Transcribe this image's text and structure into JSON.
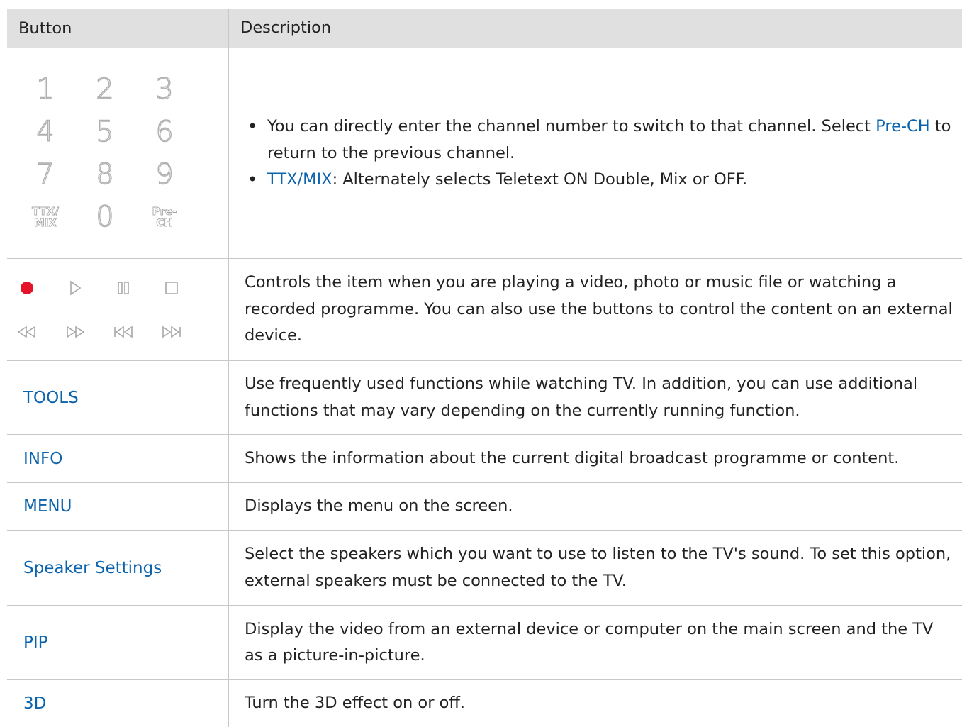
{
  "table": {
    "headers": {
      "button": "Button",
      "description": "Description"
    },
    "numpad": {
      "keys": [
        "1",
        "2",
        "3",
        "4",
        "5",
        "6",
        "7",
        "8",
        "9",
        "TTX/\nMIX",
        "0",
        "Pre-\nCH"
      ],
      "bullet1_text": "You can directly enter the channel number to switch to that channel. Select ",
      "bullet1_link": "Pre-CH",
      "bullet1_tail": " to return to the previous channel.",
      "bullet2_link": "TTX/MIX",
      "bullet2_text": ": Alternately selects Teletext ON Double, Mix or OFF."
    },
    "media": {
      "icons": [
        "record-icon",
        "play-icon",
        "pause-icon",
        "stop-icon",
        "rewind-icon",
        "fast-forward-icon",
        "previous-icon",
        "next-icon"
      ],
      "description": "Controls the item when you are playing a video, photo or music file or watching a recorded programme. You can also use the buttons to control the content on an external device."
    },
    "rows": [
      {
        "button": "TOOLS",
        "description": "Use frequently used functions while watching TV. In addition, you can use additional functions that may vary depending on the currently running function."
      },
      {
        "button": "INFO",
        "description": "Shows the information about the current digital broadcast programme or content."
      },
      {
        "button": "MENU",
        "description": "Displays the menu on the screen."
      },
      {
        "button": "Speaker Settings",
        "description": "Select the speakers which you want to use to listen to the TV's sound. To set this option, external speakers must be connected to the TV."
      },
      {
        "button": "PIP",
        "description": "Display the video from an external device or computer on the main screen and the TV as a picture-in-picture."
      },
      {
        "button": "3D",
        "description": "Turn the 3D effect on or off."
      }
    ],
    "colors": {
      "accent": "#0b63ad",
      "header_bg": "#e0e0e0",
      "border": "#c8c8c8"
    }
  }
}
